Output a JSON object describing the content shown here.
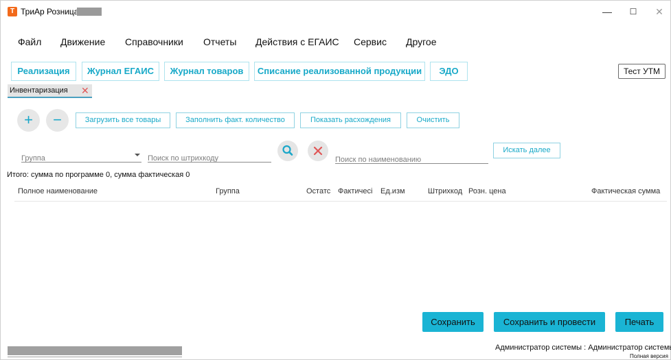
{
  "window": {
    "title": "ТриАр Розница",
    "app_icon_letter": "Т",
    "minimize": "—",
    "maximize": "☐",
    "close": "✕"
  },
  "menu": [
    "Файл",
    "Движение",
    "Справочники",
    "Отчеты",
    "Действия с ЕГАИС",
    "Сервис",
    "Другое"
  ],
  "tabs": [
    "Реализация",
    "Журнал ЕГАИС",
    "Журнал товаров",
    "Списание реализованной продукции",
    "ЭДО"
  ],
  "test_utm": "Тест УТМ",
  "document_tab": {
    "label": "Инвентаризация",
    "close": "✕"
  },
  "toolbar": {
    "add": "+",
    "remove": "−",
    "load_all": "Загрузить все товары",
    "fill_actual": "Заполнить факт. количество",
    "show_diff": "Показать расхождения",
    "clear": "Очистить"
  },
  "filters": {
    "group_placeholder": "Группа",
    "barcode_placeholder": "Поиск по штрихкоду",
    "name_placeholder": "Поиск по наименованию",
    "search_more": "Искать далее"
  },
  "summary": "Итого: сумма по программе 0, сумма фактическая 0",
  "table": {
    "columns": [
      "Полное наименование",
      "Группа",
      "Остатс",
      "Фактичесі",
      "Ед.изм",
      "Штрихкод",
      "Розн. цена",
      "Фактическая сумма"
    ],
    "rows": []
  },
  "actions": {
    "save": "Сохранить",
    "save_post": "Сохранить и провести",
    "print": "Печать"
  },
  "status": {
    "user": "Администратор системы : Администратор системы",
    "version": "Полная версия"
  },
  "colors": {
    "accent": "#1ab4d4",
    "accent_text": "#18a9c8",
    "app_icon": "#f26a1b",
    "close_red": "#e05656"
  }
}
